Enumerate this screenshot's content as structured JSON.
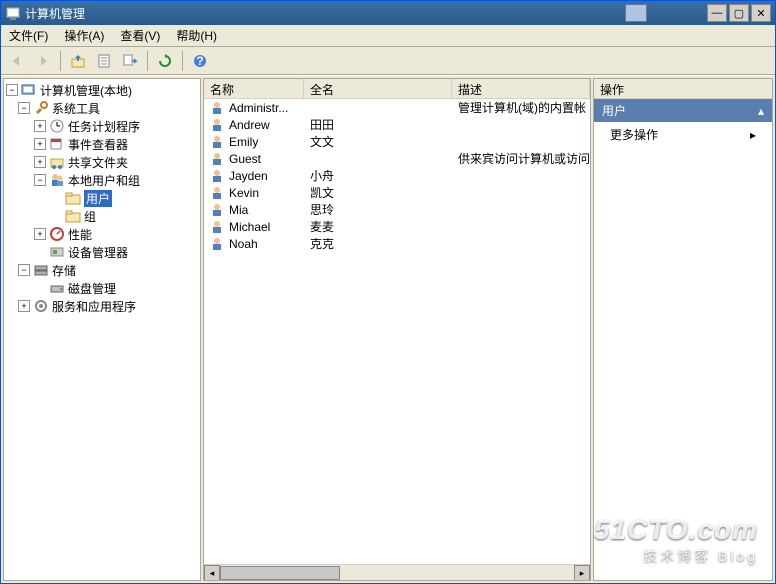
{
  "window": {
    "title": "计算机管理"
  },
  "menu": {
    "file": "文件(F)",
    "action": "操作(A)",
    "view": "查看(V)",
    "help": "帮助(H)"
  },
  "tree": {
    "root": "计算机管理(本地)",
    "systools": "系统工具",
    "taskscheduler": "任务计划程序",
    "eventviewer": "事件查看器",
    "sharedfolders": "共享文件夹",
    "localusers": "本地用户和组",
    "users": "用户",
    "groups": "组",
    "perf": "性能",
    "devmgr": "设备管理器",
    "storage": "存储",
    "diskmgmt": "磁盘管理",
    "services": "服务和应用程序"
  },
  "list": {
    "columns": {
      "name": "名称",
      "fullname": "全名",
      "desc": "描述"
    },
    "col_widths": {
      "name": 100,
      "fullname": 148,
      "desc": 140
    },
    "rows": [
      {
        "name": "Administr...",
        "fullname": "",
        "desc": "管理计算机(域)的内置帐"
      },
      {
        "name": "Andrew",
        "fullname": "田田",
        "desc": ""
      },
      {
        "name": "Emily",
        "fullname": "文文",
        "desc": ""
      },
      {
        "name": "Guest",
        "fullname": "",
        "desc": "供来宾访问计算机或访问"
      },
      {
        "name": "Jayden",
        "fullname": "小舟",
        "desc": ""
      },
      {
        "name": "Kevin",
        "fullname": "凯文",
        "desc": ""
      },
      {
        "name": "Mia",
        "fullname": "思玲",
        "desc": ""
      },
      {
        "name": "Michael",
        "fullname": "麦麦",
        "desc": ""
      },
      {
        "name": "Noah",
        "fullname": "克克",
        "desc": ""
      }
    ]
  },
  "actions": {
    "header": "操作",
    "group": "用户",
    "more": "更多操作"
  },
  "watermark": {
    "big": "51CTO.com",
    "small": "技术博客   Blog"
  }
}
